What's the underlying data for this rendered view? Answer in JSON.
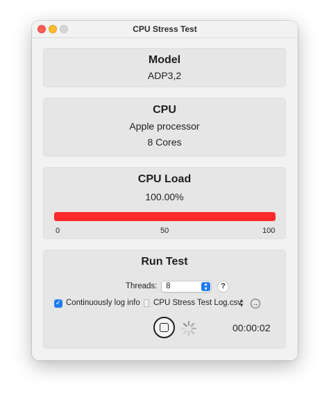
{
  "window": {
    "title": "CPU Stress Test"
  },
  "model": {
    "heading": "Model",
    "value": "ADP3,2"
  },
  "cpu": {
    "heading": "CPU",
    "name": "Apple processor",
    "cores": "8 Cores"
  },
  "cpu_load": {
    "heading": "CPU Load",
    "value_text": "100.00%",
    "percent": 100,
    "bar_color": "#ff2b2b",
    "scale": [
      "0",
      "50",
      "100"
    ]
  },
  "run_test": {
    "heading": "Run Test",
    "threads_label": "Threads:",
    "threads_value": "8",
    "help_label": "?",
    "log_checkbox_checked": true,
    "log_label": "Continuously log info",
    "log_file": "CPU Stress Test Log.csv",
    "timer": "00:00:02"
  },
  "colors": {
    "accent": "#1e7cf2",
    "close": "#ff5f57",
    "minimize": "#febc2e",
    "zoom": "#d6d6d6"
  },
  "icons": {
    "stop": "stop-icon",
    "spinner": "spinner-icon",
    "file": "document-icon",
    "reveal": "arrow-right-circle-icon",
    "stepper": "chevron-up-down-icon"
  }
}
